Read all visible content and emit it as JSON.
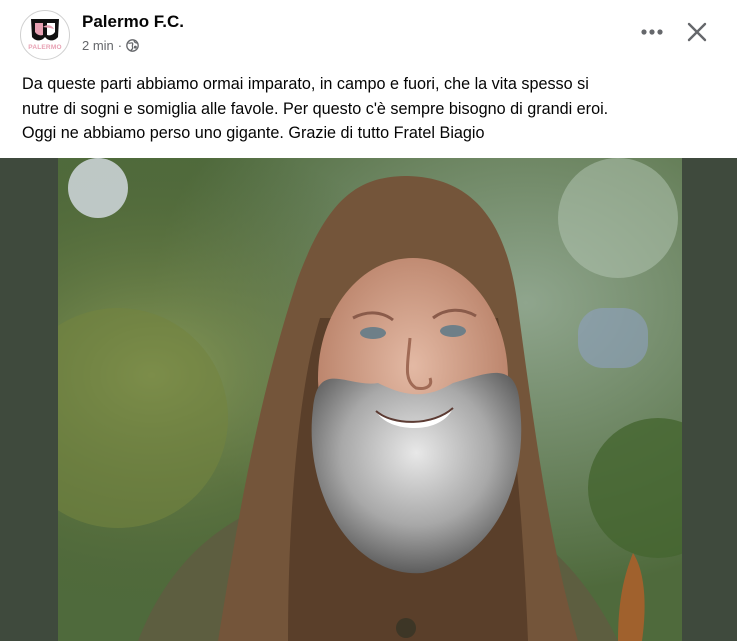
{
  "post": {
    "page_name": "Palermo F.C.",
    "timestamp": "2 min",
    "separator": "·",
    "privacy_icon": "globe-icon",
    "avatar_label": "PALERMO",
    "caption_lines": [
      "Da queste parti abbiamo ormai imparato, in campo e fuori, che la vita spesso si",
      "nutre di sogni e somiglia alle favole. Per questo c'è sempre bisogno di grandi eroi.",
      "Oggi ne abbiamo perso uno gigante. Grazie di tutto Fratel Biagio"
    ]
  },
  "actions": {
    "more_icon": "more-options-icon",
    "close_icon": "close-icon"
  },
  "colors": {
    "text_primary": "#050505",
    "text_secondary": "#65676b",
    "media_background": "#3f4a3d",
    "logo_pink": "#e8a1b3"
  }
}
